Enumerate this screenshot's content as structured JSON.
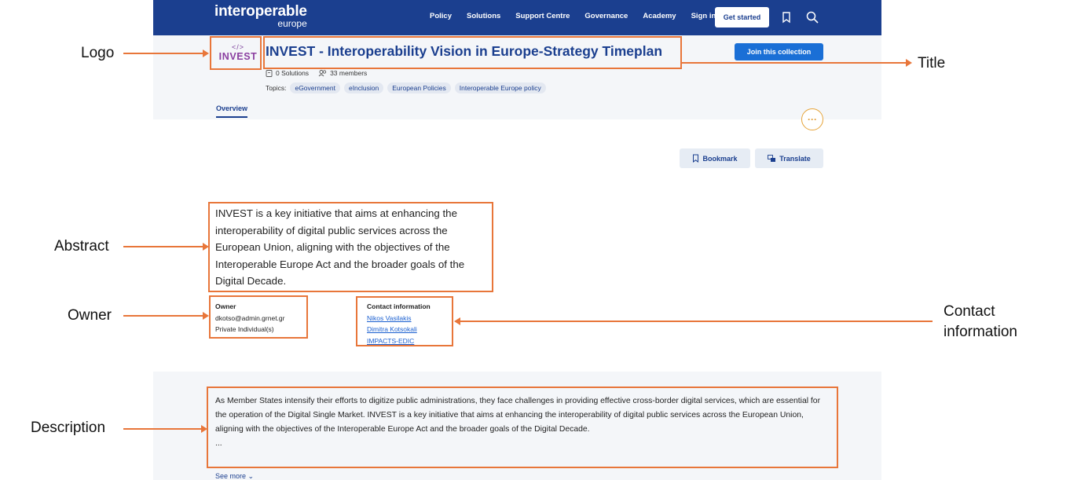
{
  "brand": {
    "main": "interoperable",
    "sub": "europe"
  },
  "nav": [
    "Policy",
    "Solutions",
    "Support Centre",
    "Governance",
    "Academy",
    "Sign in"
  ],
  "get_started": "Get started",
  "logo": {
    "code": "</>",
    "word": "INVEST"
  },
  "title": "INVEST - Interoperability Vision in Europe-Strategy Timeplan",
  "join_button": "Join this collection",
  "stats": {
    "solutions": "0 Solutions",
    "members": "33 members"
  },
  "topics": {
    "label": "Topics:",
    "items": [
      "eGovernment",
      "eInclusion",
      "European Policies",
      "Interoperable Europe policy"
    ]
  },
  "tab": "Overview",
  "more": "···",
  "actions": {
    "bookmark": "Bookmark",
    "translate": "Translate"
  },
  "abstract": "INVEST is a key initiative that aims at enhancing the interoperability of digital public services across the European Union, aligning with the objectives of the Interoperable Europe Act and the broader goals of the Digital Decade.",
  "owner": {
    "label": "Owner",
    "email": "dkotso@admin.grnet.gr",
    "type": "Private Individual(s)"
  },
  "contact": {
    "label": "Contact information",
    "links": [
      "Nikos Vasilakis",
      "Dimitra Kotsokali",
      "IMPACTS-EDIC"
    ]
  },
  "description": "As Member States intensify their efforts to digitize public administrations, they face challenges in providing effective cross-border digital services, which are essential for the operation of the Digital Single Market. INVEST is a key initiative that aims at enhancing the interoperability of digital public services across the European Union, aligning with the objectives of the Interoperable Europe Act and the broader goals of the Digital Decade.",
  "description_ellipsis": "...",
  "see_more": "See more",
  "annotations": {
    "logo": "Logo",
    "title": "Title",
    "abstract": "Abstract",
    "owner": "Owner",
    "contact_line1": "Contact",
    "contact_line2": "information",
    "description": "Description"
  },
  "colors": {
    "nav_bg": "#1b3f8f",
    "accent": "#1a6fd6",
    "annotation": "#e8763a",
    "logo": "#8a3fa0"
  }
}
